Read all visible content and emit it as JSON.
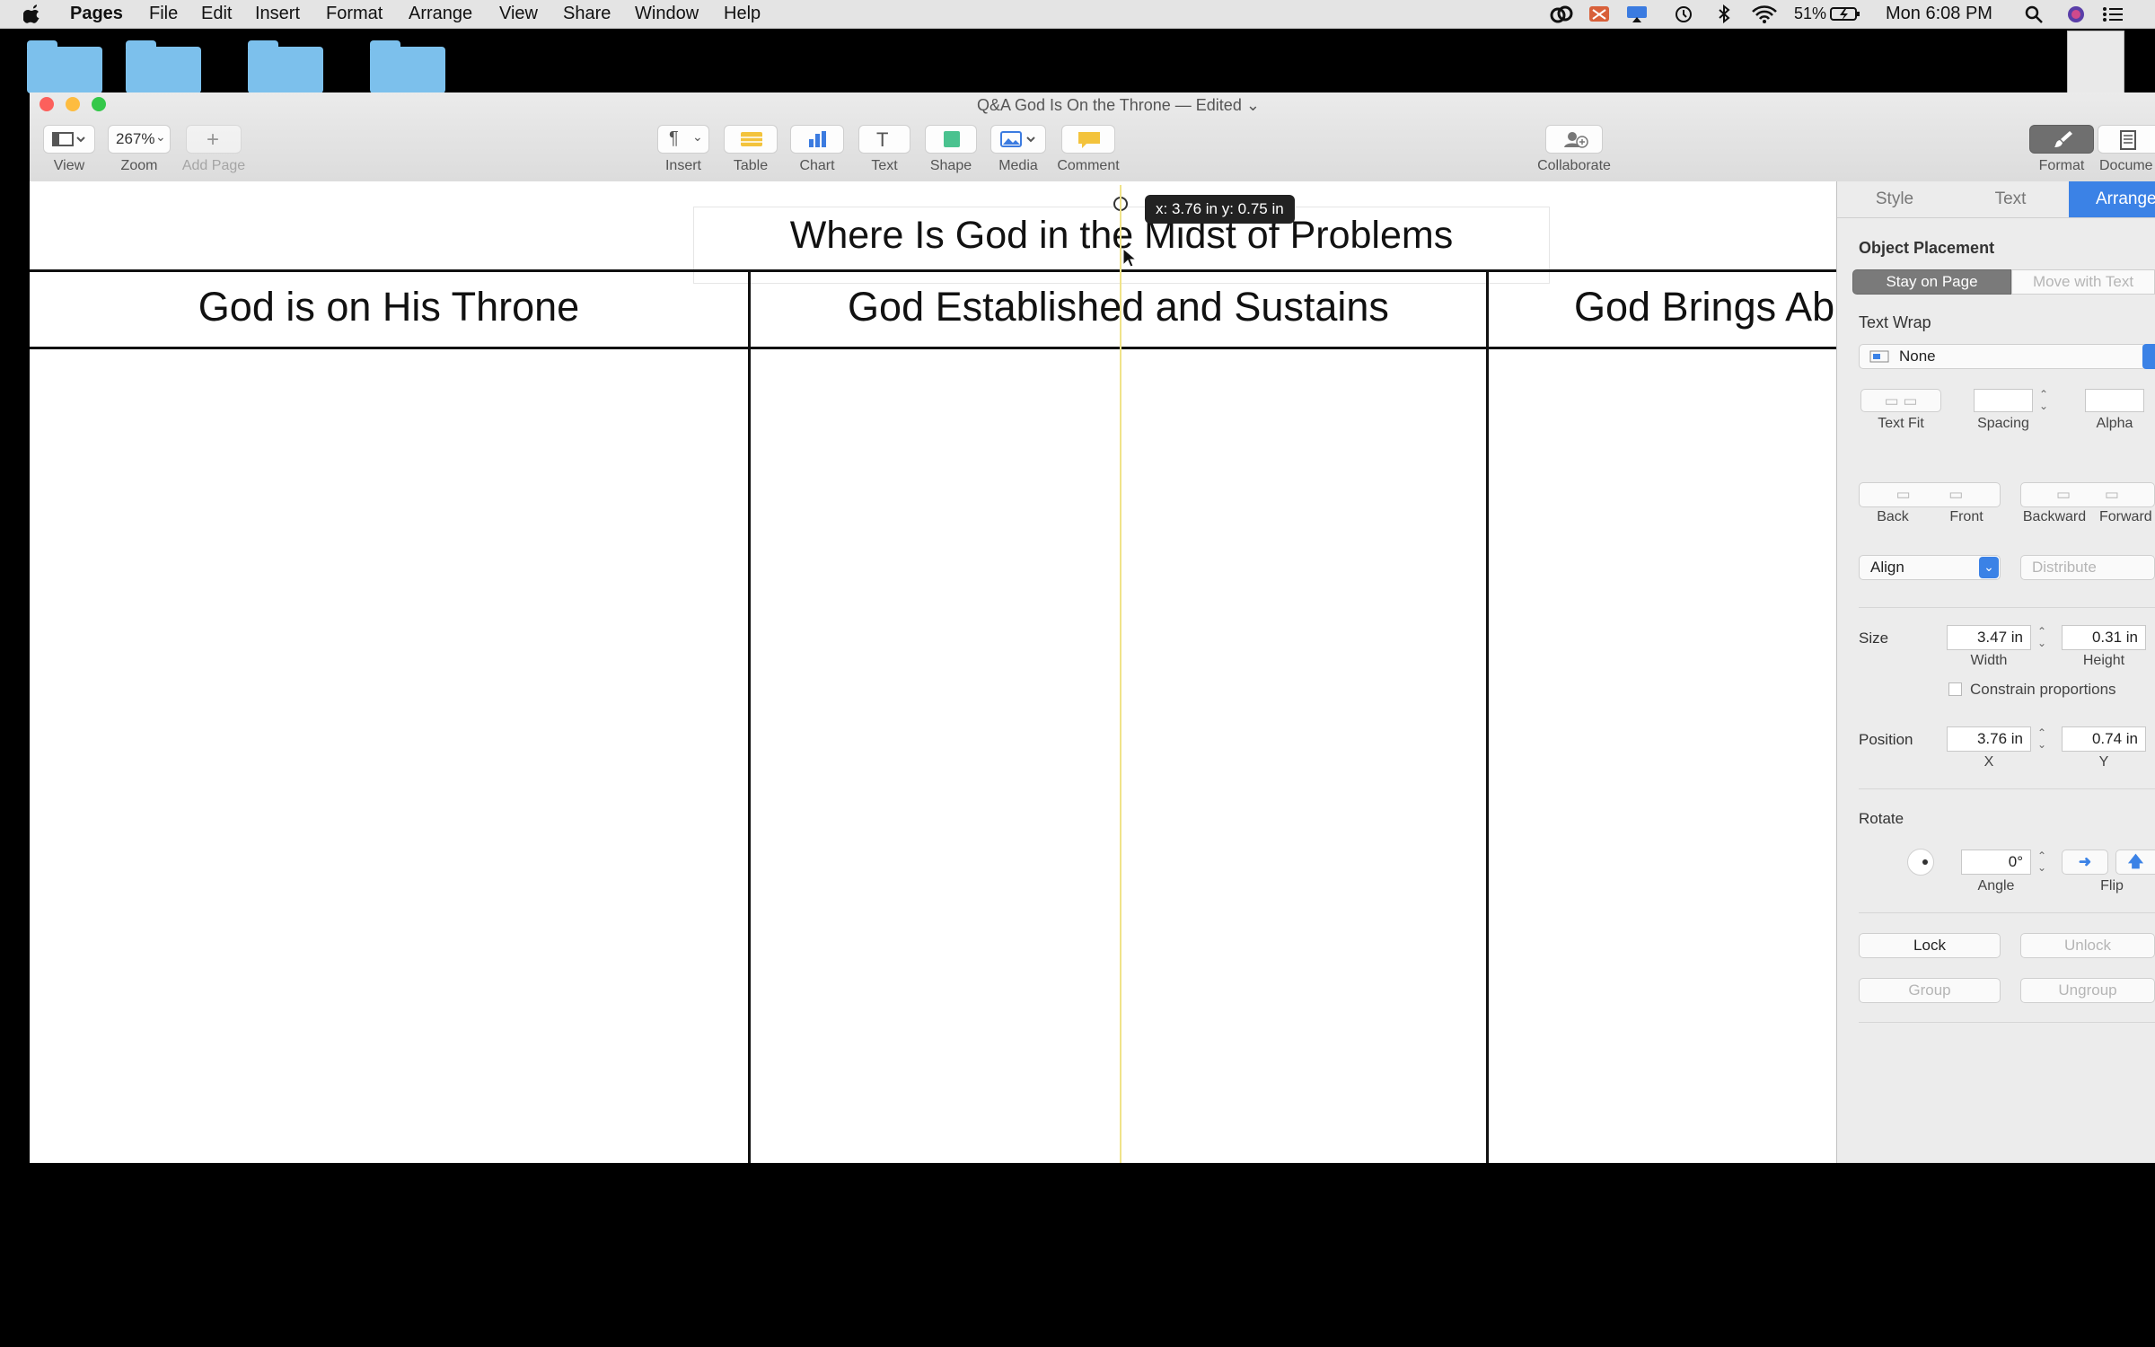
{
  "menubar": {
    "app": "Pages",
    "items": [
      "File",
      "Edit",
      "Insert",
      "Format",
      "Arrange",
      "View",
      "Share",
      "Window",
      "Help"
    ],
    "battery": "51%",
    "clock": "Mon 6:08 PM"
  },
  "window": {
    "title": "Q&A God Is On the Throne — Edited",
    "traffic_colors": [
      "#fc605c",
      "#fdbc40",
      "#34c84a"
    ]
  },
  "toolbar": {
    "view": "View",
    "zoom_value": "267%",
    "zoom": "Zoom",
    "add_page": "Add Page",
    "insert": "Insert",
    "table": "Table",
    "chart": "Chart",
    "text": "Text",
    "shape": "Shape",
    "media": "Media",
    "comment": "Comment",
    "collaborate": "Collaborate",
    "format": "Format",
    "document": "Docume"
  },
  "document": {
    "title": "Where Is God in the Midst of Problems",
    "columns": [
      "God is on His Throne",
      "God Established and Sustains",
      "God Brings Ab"
    ],
    "tooltip": "x: 3.76 in  y: 0.75 in"
  },
  "inspector": {
    "tabs": [
      "Style",
      "Text",
      "Arrange"
    ],
    "active_tab": "Arrange",
    "object_placement": "Object Placement",
    "stay_on_page": "Stay on Page",
    "move_with_text": "Move with Text",
    "text_wrap": "Text Wrap",
    "text_wrap_value": "None",
    "text_fit": "Text Fit",
    "spacing": "Spacing",
    "alpha": "Alpha",
    "back": "Back",
    "front": "Front",
    "backward": "Backward",
    "forward": "Forward",
    "align": "Align",
    "distribute": "Distribute",
    "size": "Size",
    "width_value": "3.47 in",
    "height_value": "0.31 in",
    "width": "Width",
    "height": "Height",
    "constrain": "Constrain proportions",
    "position": "Position",
    "x_value": "3.76 in",
    "y_value": "0.74 in",
    "x": "X",
    "y": "Y",
    "rotate": "Rotate",
    "angle_value": "0°",
    "angle": "Angle",
    "flip": "Flip",
    "lock": "Lock",
    "unlock": "Unlock",
    "group": "Group",
    "ungroup": "Ungroup",
    "accent": "#3b82e6"
  }
}
